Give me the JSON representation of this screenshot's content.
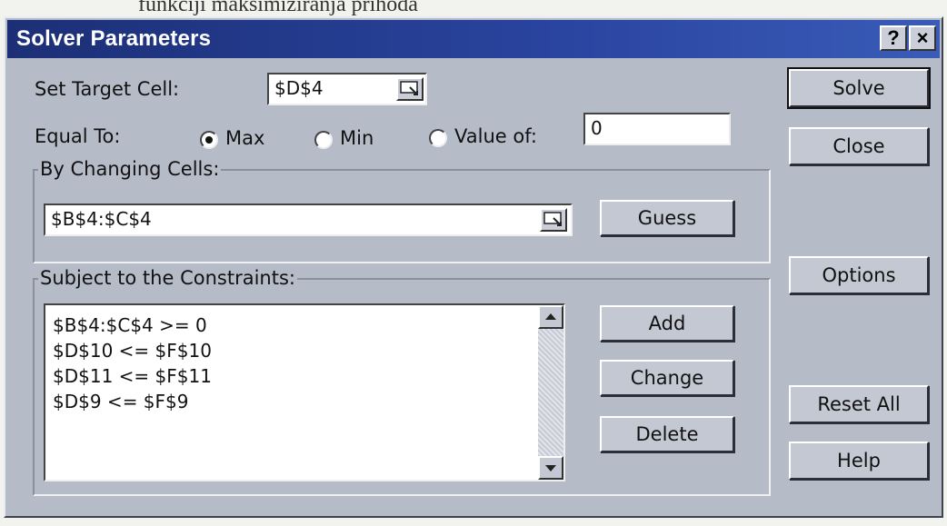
{
  "caption": "funkciji maksimiziranja prihoda",
  "window": {
    "title": "Solver Parameters",
    "help_button": "?",
    "close_button": "×"
  },
  "target": {
    "label": "Set Target Cell:",
    "value": "$D$4",
    "ref_icon": "range-selector-icon"
  },
  "equal_to": {
    "label": "Equal To:",
    "options": [
      {
        "label": "Max",
        "selected": true
      },
      {
        "label": "Min",
        "selected": false
      },
      {
        "label": "Value of:",
        "selected": false
      }
    ],
    "value_of": "0"
  },
  "changing_cells": {
    "group_title": "By Changing Cells:",
    "value": "$B$4:$C$4",
    "ref_icon": "range-selector-icon",
    "guess_label": "Guess"
  },
  "constraints": {
    "group_title": "Subject to the Constraints:",
    "items": [
      "$B$4:$C$4 >= 0",
      "$D$10 <= $F$10",
      "$D$11 <= $F$11",
      "$D$9 <= $F$9"
    ],
    "add_label": "Add",
    "change_label": "Change",
    "delete_label": "Delete"
  },
  "actions": {
    "solve": "Solve",
    "close": "Close",
    "options": "Options",
    "reset_all": "Reset All",
    "help": "Help"
  },
  "colors": {
    "title_bar": "#1c2f76",
    "dialog_face": "#b5bcc8",
    "button_face": "#c3c8d2"
  }
}
